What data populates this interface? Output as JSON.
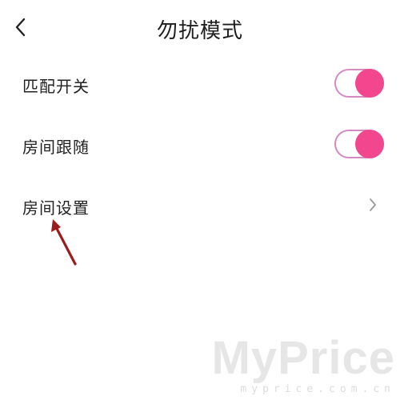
{
  "header": {
    "back_icon": "chevron-left-icon",
    "title": "勿扰模式"
  },
  "settings": [
    {
      "label": "匹配开关",
      "control": "toggle",
      "state": "on"
    },
    {
      "label": "房间跟随",
      "control": "toggle",
      "state": "on"
    },
    {
      "label": "房间设置",
      "control": "chevron",
      "icon": "chevron-right-icon"
    }
  ],
  "colors": {
    "toggle_on": "#f2468e",
    "toggle_border": "#d58ac0",
    "annotation_arrow": "#9b1c1c"
  },
  "watermark": {
    "brand": "MyPrice",
    "domain": "myprice.com.cn"
  }
}
